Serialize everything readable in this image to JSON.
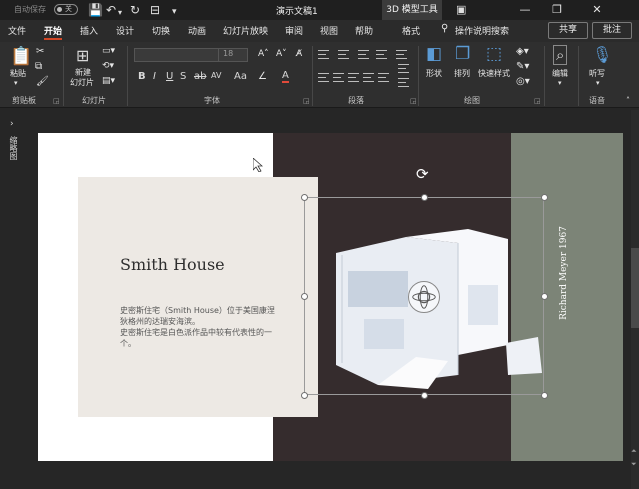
{
  "titlebar": {
    "autosave_label": "自动保存",
    "autosave_state": "关",
    "doc_title": "演示文稿1",
    "contextual_tab": "3D 模型工具",
    "minimize": "—",
    "restore": "❐",
    "close": "✕"
  },
  "tabs": {
    "items": [
      "文件",
      "开始",
      "插入",
      "设计",
      "切换",
      "动画",
      "幻灯片放映",
      "审阅",
      "视图",
      "帮助",
      "格式"
    ],
    "active": "开始",
    "search": "操作说明搜索",
    "share": "共享",
    "comment": "批注"
  },
  "ribbon": {
    "clipboard": {
      "paste": "粘贴",
      "group": "剪贴板"
    },
    "slides": {
      "new_slide_line1": "新建",
      "new_slide_line2": "幻灯片",
      "group": "幻灯片"
    },
    "font": {
      "size": "18",
      "group": "字体"
    },
    "paragraph": {
      "group": "段落"
    },
    "drawing": {
      "shapes": "形状",
      "arrange": "排列",
      "quick_styles": "快速样式",
      "group": "绘图"
    },
    "editing": {
      "label": "编辑"
    },
    "voice": {
      "dictate": "听写",
      "group": "语音"
    }
  },
  "pane": {
    "label": "缩略图"
  },
  "slide": {
    "title": "Smith House",
    "body_line1": "史密斯住宅（Smith House）位于美国康涅狄格州的达瑞安海滨。",
    "body_line2": "史密斯住宅是白色派作品中较有代表性的一个。",
    "side_text": "Richard Meyer 1967"
  },
  "colors": {
    "accent": "#d24726",
    "slide_dark": "#352c2d",
    "slide_green": "#7c8477",
    "card": "#ede9e4"
  }
}
